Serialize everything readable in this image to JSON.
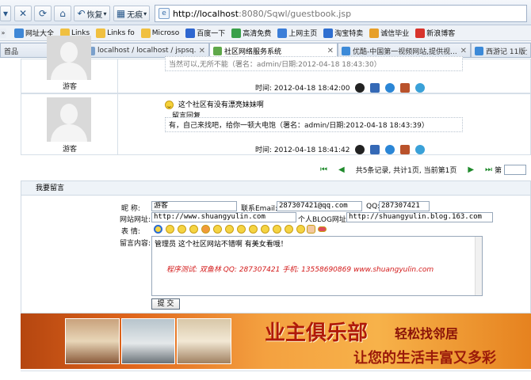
{
  "browser": {
    "nav_buttons": {
      "back_label": "恢复",
      "tools_label": "无痕"
    },
    "url_host": "http://localhost",
    "url_rest": ":8080/Sqwl/guestbook.jsp",
    "favorites": [
      "网址大全",
      "Links",
      "Links fo",
      "Microso",
      "百度一下",
      "高清免费",
      "上网主页",
      "淘宝特卖",
      "诚信毕业",
      "新浪博客"
    ],
    "tabs": [
      {
        "label": "首品"
      },
      {
        "label": "localhost / localhost / jspsq..."
      },
      {
        "label": "社区网络服务系统",
        "active": true
      },
      {
        "label": "优酷-中国第一视频网站,提供视..."
      },
      {
        "label": "西游记 11版全集"
      }
    ]
  },
  "messages": [
    {
      "user": "游客",
      "body": "当然可以,无所不能（署名：admin/日期:2012-04-18 18:43:30）",
      "time": "时间:  2012-04-18 18:42:00"
    },
    {
      "user": "游客",
      "text": "这个社区有没有漂亮妹妹啊",
      "reply_title": "留言回复",
      "reply": "有，自己来找吧，给你一顿大电饱（署名：admin/日期:2012-04-18 18:43:39）",
      "time": "时间:  2012-04-18 18:41:42"
    }
  ],
  "pager": {
    "text": "共5条记录, 共计1页, 当前第1页",
    "goto_label": "第"
  },
  "form": {
    "title": "我要留言",
    "nickname_label": "昵    称:",
    "nickname_value": "游客",
    "email_label": "联系Email:",
    "email_value": "287307421@qq.com",
    "qq_label": "QQ:",
    "qq_value": "287307421",
    "site_label": "网站网址:",
    "site_value": "http://www.shuangyulin.com",
    "blog_label": "个人BLOG网址:",
    "blog_value": "http://shuangyulin.blog.163.com",
    "emotion_label": "表    情:",
    "content_label": "留言内容:",
    "content_value": "管理员  这个社区网站不错啊  有美女看哦！",
    "signature": "程序测试: 双鱼林   QQ: 287307421   手机: 13558690869   www.shuangyulin.com",
    "submit_label": "提 交"
  },
  "banner": {
    "title": "业主俱乐部",
    "subtitle": "轻松找邻居",
    "slogan": "让您的生活丰富又多彩"
  }
}
